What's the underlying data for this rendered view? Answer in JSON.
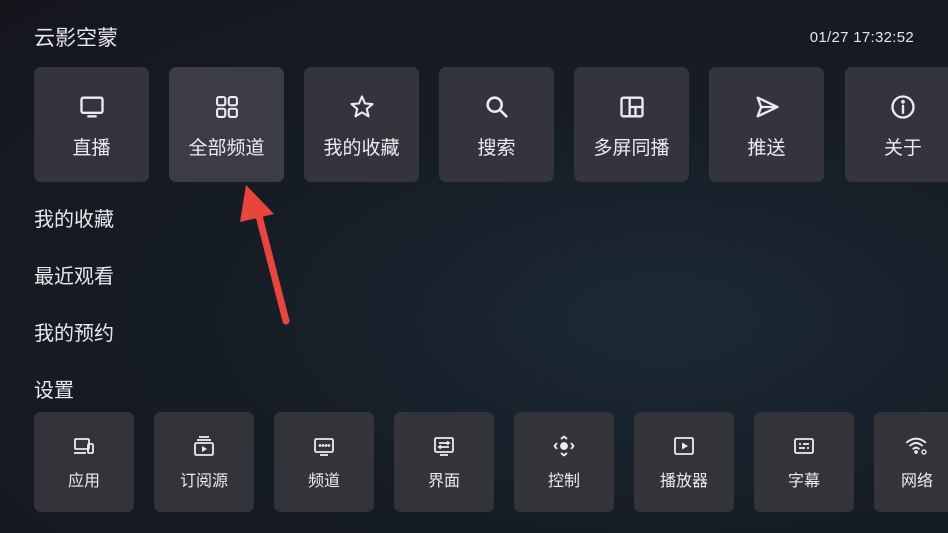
{
  "header": {
    "app_title": "云影空蒙",
    "datetime": "01/27 17:32:52"
  },
  "top_menu": [
    {
      "label": "直播",
      "icon": "tv-icon"
    },
    {
      "label": "全部频道",
      "icon": "grid-icon"
    },
    {
      "label": "我的收藏",
      "icon": "star-icon"
    },
    {
      "label": "搜索",
      "icon": "search-icon"
    },
    {
      "label": "多屏同播",
      "icon": "multiscreen-icon"
    },
    {
      "label": "推送",
      "icon": "send-icon"
    },
    {
      "label": "关于",
      "icon": "info-icon"
    }
  ],
  "side_links": [
    {
      "label": "我的收藏"
    },
    {
      "label": "最近观看"
    },
    {
      "label": "我的预约"
    }
  ],
  "settings": {
    "title": "设置",
    "items": [
      {
        "label": "应用",
        "icon": "devices-icon"
      },
      {
        "label": "订阅源",
        "icon": "subscription-icon"
      },
      {
        "label": "频道",
        "icon": "channel-icon"
      },
      {
        "label": "界面",
        "icon": "interface-icon"
      },
      {
        "label": "控制",
        "icon": "dpad-icon"
      },
      {
        "label": "播放器",
        "icon": "play-icon"
      },
      {
        "label": "字幕",
        "icon": "subtitles-icon"
      },
      {
        "label": "网络",
        "icon": "wifi-settings-icon"
      }
    ]
  },
  "annotation": {
    "color": "#e8453c"
  }
}
